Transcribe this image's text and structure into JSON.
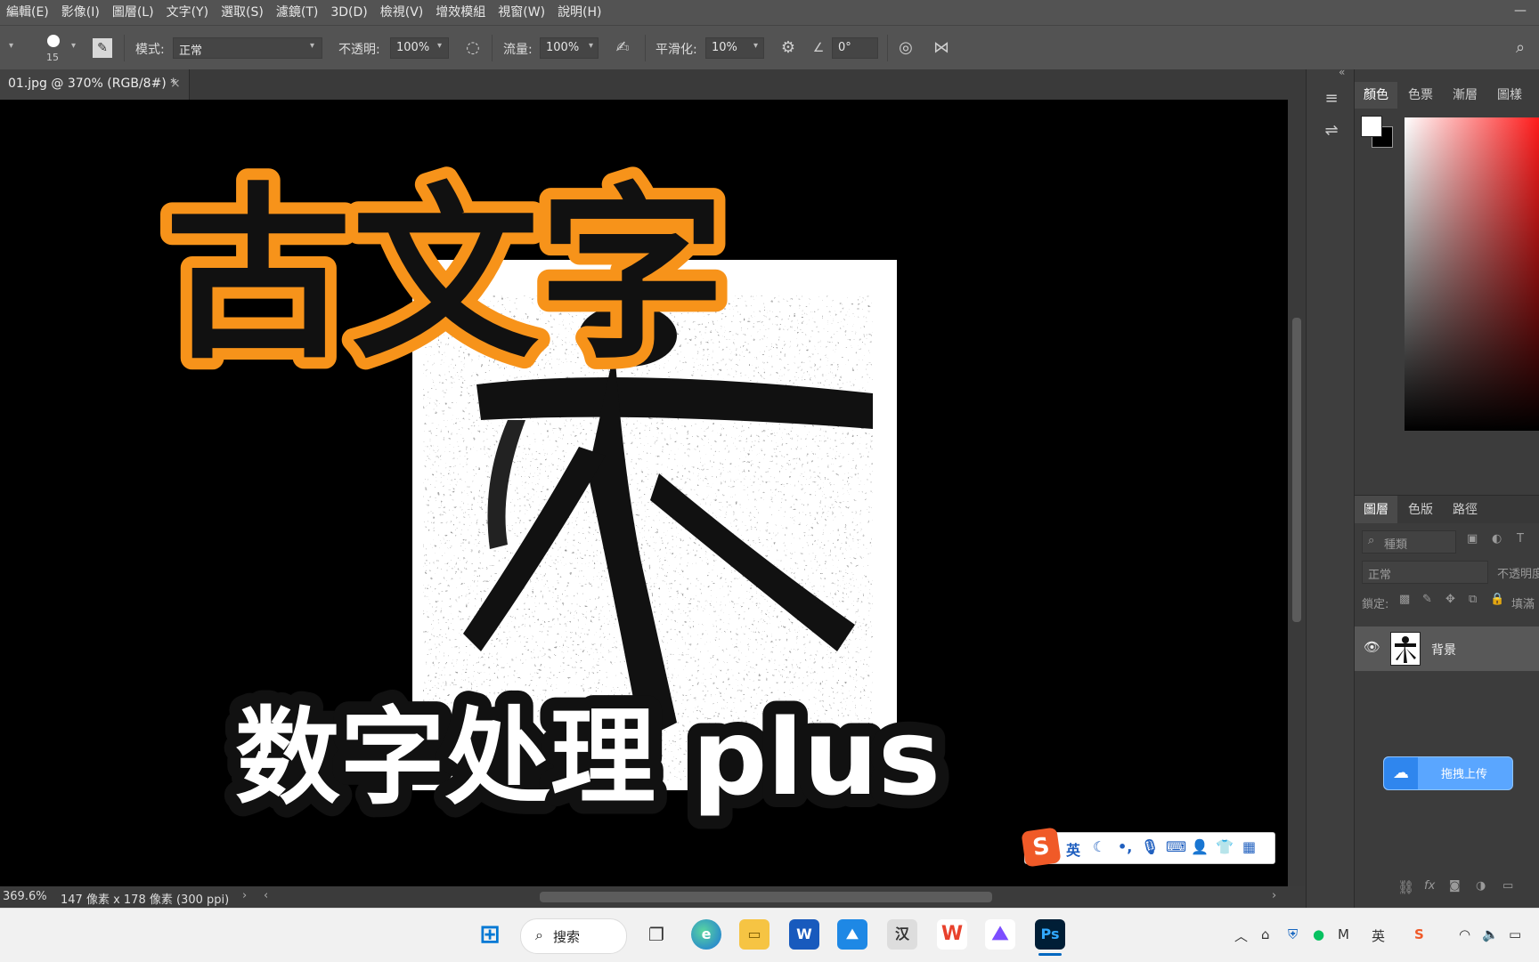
{
  "menu": [
    "編輯(E)",
    "影像(I)",
    "圖層(L)",
    "文字(Y)",
    "選取(S)",
    "濾鏡(T)",
    "3D(D)",
    "檢視(V)",
    "增效模組",
    "視窗(W)",
    "說明(H)"
  ],
  "options": {
    "brush_size": "15",
    "mode_label": "模式:",
    "mode_value": "正常",
    "opacity_label": "不透明:",
    "opacity_value": "100%",
    "flow_label": "流量:",
    "flow_value": "100%",
    "smoothing_label": "平滑化:",
    "smoothing_value": "10%",
    "angle_value": "0°"
  },
  "document": {
    "tab_label": "01.jpg @ 370% (RGB/8#) *",
    "close_glyph": "×",
    "overlay_title": "古文字",
    "overlay_subtitle": "数字处理 plus"
  },
  "status": {
    "zoom": "369.6%",
    "info": "147 像素 x 178 像素 (300 ppi)"
  },
  "color_panel": {
    "tabs": [
      "顏色",
      "色票",
      "漸層",
      "圖樣"
    ]
  },
  "layers_panel": {
    "tabs": [
      "圖層",
      "色版",
      "路徑"
    ],
    "filter_placeholder": "種類",
    "blend_mode": "正常",
    "opacity_label": "不透明度",
    "lock_label": "鎖定:",
    "fill_label": "填滿",
    "layer_name": "背景"
  },
  "upload_button": "拖拽上传",
  "ime": {
    "lang": "英"
  },
  "taskbar": {
    "search_label": "搜索",
    "apps": [
      "windows-start",
      "search",
      "task-view",
      "edge",
      "file-explorer",
      "word",
      "maps",
      "hanzi-app",
      "wps",
      "pictures",
      "photoshop"
    ],
    "ps_label": "Ps",
    "hanzi_label": "汉",
    "tray_input": "英"
  },
  "colors": {
    "accent_orange": "#f7931a",
    "ps_blue": "#31a8ff",
    "spectrum_red": "#ff1a1a"
  }
}
